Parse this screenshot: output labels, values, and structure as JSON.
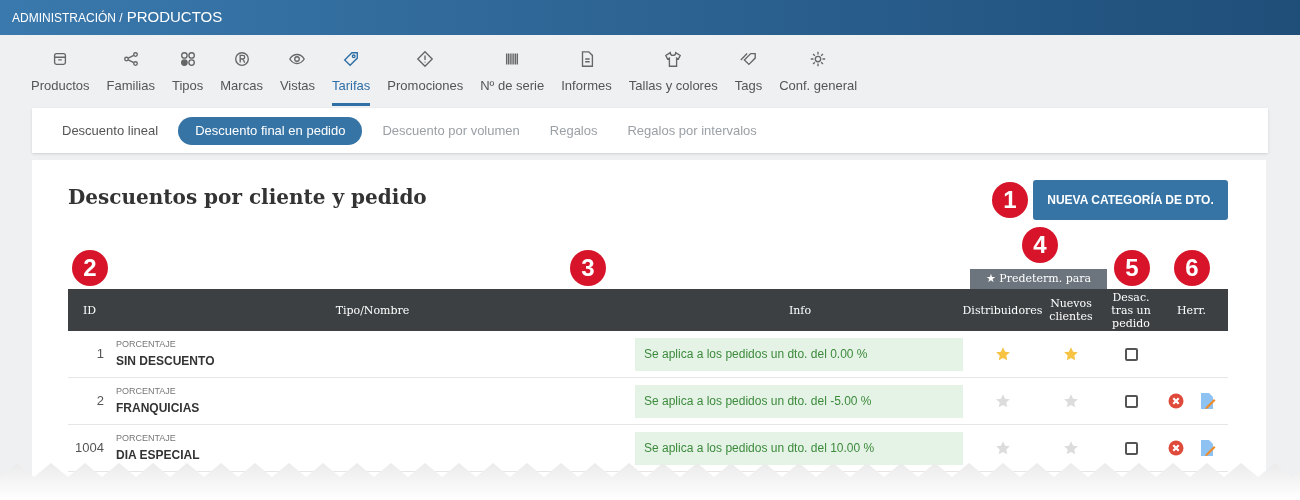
{
  "header": {
    "section": "ADMINISTRACIÓN /",
    "title": "PRODUCTOS"
  },
  "nav_tabs": [
    {
      "label": "Productos",
      "selected": false
    },
    {
      "label": "Familias",
      "selected": false
    },
    {
      "label": "Tipos",
      "selected": false
    },
    {
      "label": "Marcas",
      "selected": false
    },
    {
      "label": "Vistas",
      "selected": false
    },
    {
      "label": "Tarifas",
      "selected": true
    },
    {
      "label": "Promociones",
      "selected": false
    },
    {
      "label": "Nº de serie",
      "selected": false
    },
    {
      "label": "Informes",
      "selected": false
    },
    {
      "label": "Tallas y colores",
      "selected": false
    },
    {
      "label": "Tags",
      "selected": false
    },
    {
      "label": "Conf. general",
      "selected": false
    }
  ],
  "sub_tabs": [
    {
      "label": "Descuento lineal",
      "selected": false,
      "disabled": false
    },
    {
      "label": "Descuento final en pedido",
      "selected": true,
      "disabled": false
    },
    {
      "label": "Descuento por volumen",
      "selected": false,
      "disabled": true
    },
    {
      "label": "Regalos",
      "selected": false,
      "disabled": true
    },
    {
      "label": "Regalos por intervalos",
      "selected": false,
      "disabled": true
    }
  ],
  "page_title": "Descuentos por cliente y pedido",
  "new_button": "NUEVA CATEGORÍA DE DTO.",
  "callouts": [
    "1",
    "2",
    "3",
    "4",
    "5",
    "6"
  ],
  "table": {
    "group_header": "★ Predeterm. para",
    "columns": [
      "ID",
      "Tipo/Nombre",
      "Info",
      "Distribuidores",
      "Nuevos clientes",
      "Desac. tras un pedido",
      "Herr."
    ],
    "rows": [
      {
        "id": "1",
        "type": "PORCENTAJE",
        "name": "SIN DESCUENTO",
        "info": "Se aplica a los pedidos un dto. del 0.00 %",
        "default_distributors": true,
        "default_new_clients": true,
        "deactivate_after_order": false,
        "tools": false
      },
      {
        "id": "2",
        "type": "PORCENTAJE",
        "name": "FRANQUICIAS",
        "info": "Se aplica a los pedidos un dto. del -5.00 %",
        "default_distributors": false,
        "default_new_clients": false,
        "deactivate_after_order": false,
        "tools": true
      },
      {
        "id": "1004",
        "type": "PORCENTAJE",
        "name": "DIA ESPECIAL",
        "info": "Se aplica a los pedidos un dto. del 10.00 %",
        "default_distributors": false,
        "default_new_clients": false,
        "deactivate_after_order": false,
        "tools": true
      }
    ]
  }
}
